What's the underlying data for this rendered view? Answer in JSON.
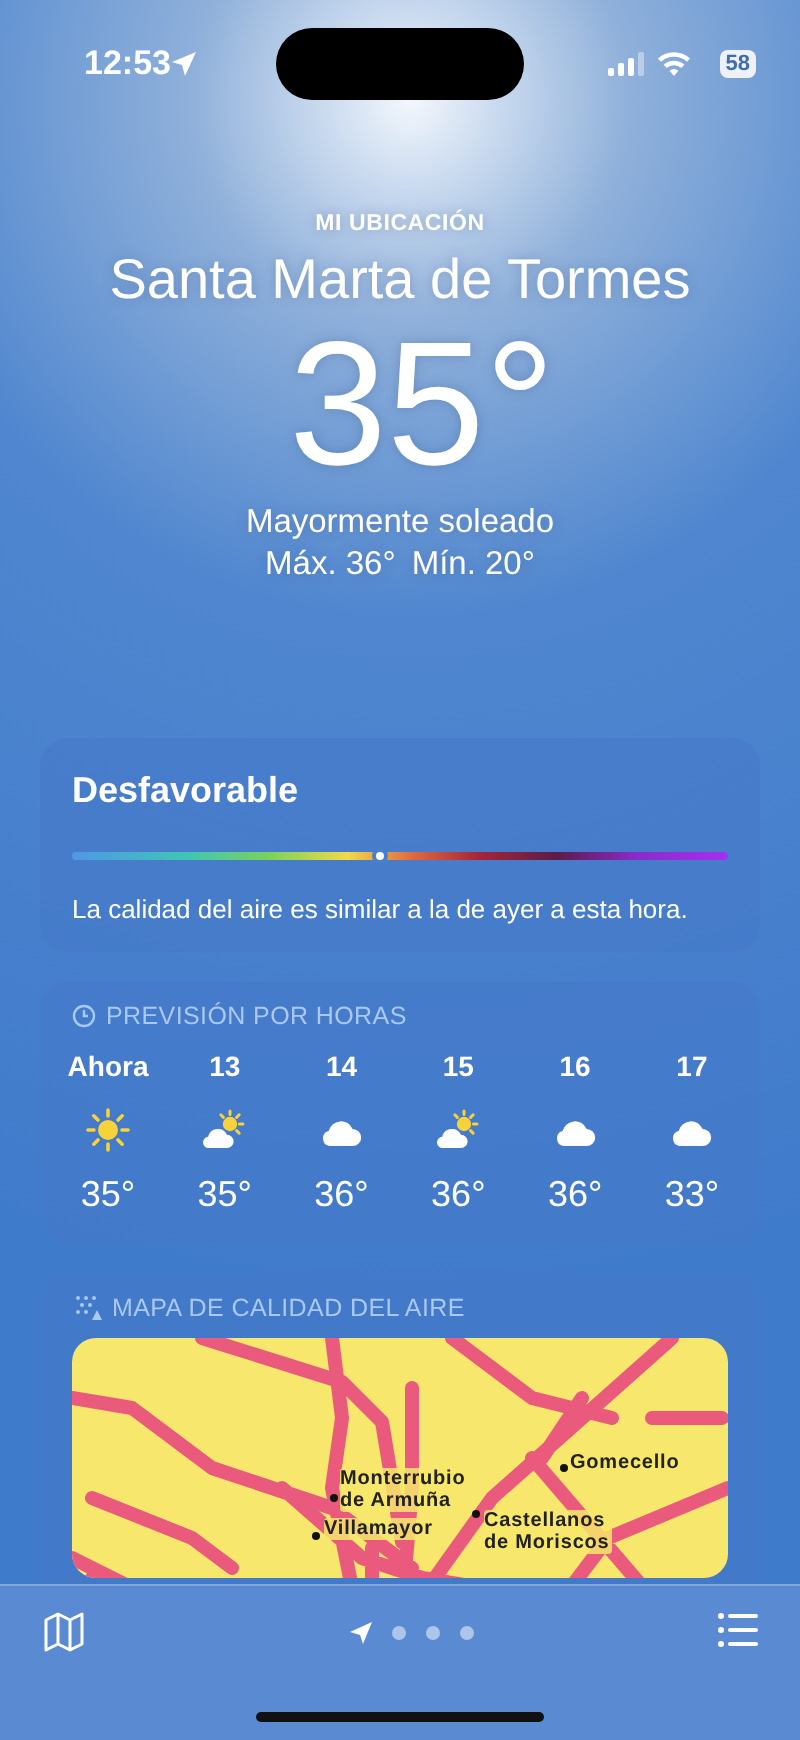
{
  "status_bar": {
    "time": "12:53",
    "battery": "58"
  },
  "header": {
    "label": "MI UBICACIÓN",
    "city": "Santa Marta de Tormes",
    "temperature": "35°",
    "condition": "Mayormente soleado",
    "high": "Máx. 36°",
    "low": "Mín. 20°"
  },
  "air_quality": {
    "category": "Desfavorable",
    "level": 0.47,
    "description": "La calidad del aire es similar a la de ayer a esta hora."
  },
  "hourly": {
    "title": "PREVISIÓN POR HORAS",
    "items": [
      {
        "time": "Ahora",
        "kind": "sun",
        "temp": "35°"
      },
      {
        "time": "13",
        "kind": "partly_cloudy",
        "temp": "35°"
      },
      {
        "time": "14",
        "kind": "cloud",
        "temp": "36°"
      },
      {
        "time": "15",
        "kind": "partly_cloudy",
        "temp": "36°"
      },
      {
        "time": "16",
        "kind": "cloud",
        "temp": "36°"
      },
      {
        "time": "17",
        "kind": "cloud",
        "temp": "33°"
      }
    ]
  },
  "air_map": {
    "title": "MAPA DE CALIDAD DEL AIRE",
    "places": [
      {
        "name": "Monterrubio de Armuña"
      },
      {
        "name": "Villamayor"
      },
      {
        "name": "Castellanos de Moriscos"
      },
      {
        "name": "Gomecello"
      }
    ]
  },
  "toolbar": {
    "pages": [
      {
        "kind": "location",
        "selected": true
      },
      {
        "kind": "dot",
        "selected": false
      },
      {
        "kind": "dot",
        "selected": false
      },
      {
        "kind": "dot",
        "selected": false
      }
    ]
  }
}
